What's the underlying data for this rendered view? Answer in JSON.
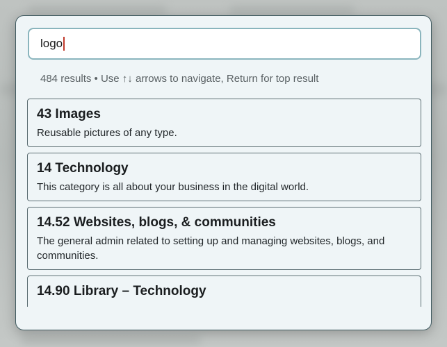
{
  "search": {
    "value": "logo"
  },
  "hint": "484 results • Use ↑↓ arrows to navigate, Return for top result",
  "results": [
    {
      "title": "43 Images",
      "description": "Reusable pictures of any type."
    },
    {
      "title": "14 Technology",
      "description": "This category is all about your business in the digital world."
    },
    {
      "title": "14.52 Websites, blogs, & communities",
      "description": "The general admin related to setting up and managing websites, blogs, and communities."
    },
    {
      "title": "14.90 Library – Technology",
      "description": ""
    }
  ],
  "colors": {
    "modal_background": "#eff5f7",
    "input_border": "#8ab5bd",
    "caret": "#c0392b"
  }
}
